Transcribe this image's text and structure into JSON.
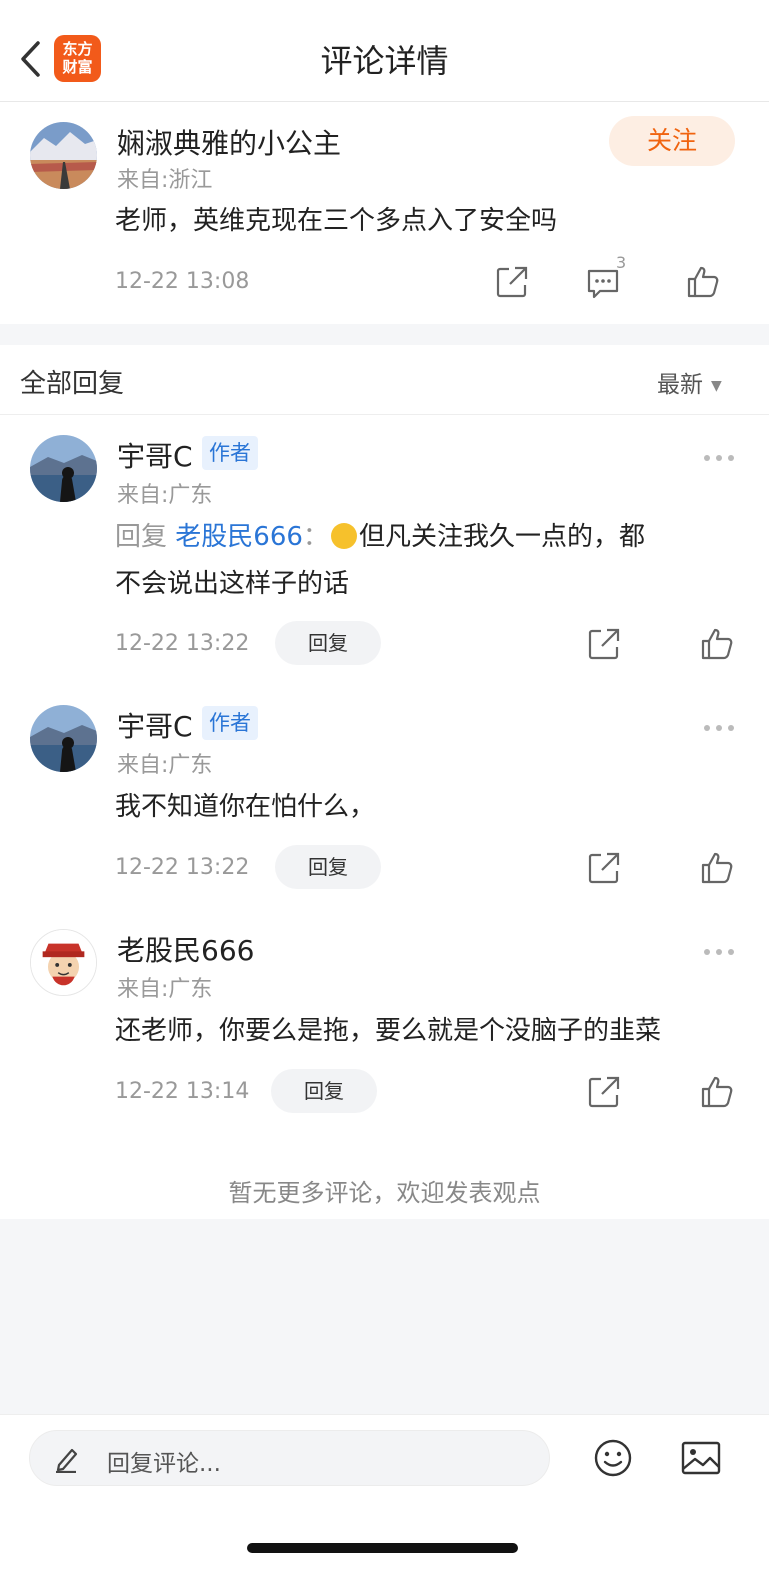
{
  "header": {
    "title": "评论详情",
    "logo_line1": "东方",
    "logo_line2": "财富"
  },
  "main_comment": {
    "author": "娴淑典雅的小公主",
    "origin": "来自:浙江",
    "follow_label": "关注",
    "text": "老师，英维克现在三个多点入了安全吗",
    "time": "12-22 13:08",
    "comment_count": "3"
  },
  "replies_header": {
    "title": "全部回复",
    "sort_label": "最新"
  },
  "replies": [
    {
      "author": "宇哥C",
      "badge": "作者",
      "origin": "来自:广东",
      "reply_prefix": "回复",
      "reply_to": "老股民666",
      "reply_sep": "：",
      "text_line1": "但凡关注我久一点的，都",
      "text_line2": "不会说出这样子的话",
      "time": "12-22 13:22",
      "reply_label": "回复"
    },
    {
      "author": "宇哥C",
      "badge": "作者",
      "origin": "来自:广东",
      "text": "我不知道你在怕什么，",
      "time": "12-22 13:22",
      "reply_label": "回复"
    },
    {
      "author": "老股民666",
      "origin": "来自:广东",
      "text": "还老师，你要么是拖，要么就是个没脑子的韭菜",
      "time": "12-22 13:14",
      "reply_label": "回复"
    }
  ],
  "no_more_text": "暂无更多评论，欢迎发表观点",
  "bottom_bar": {
    "input_placeholder": "回复评论..."
  },
  "icons": {
    "back": "chevron-left-icon",
    "share": "share-icon",
    "comment": "comment-icon",
    "like": "thumbs-up-icon",
    "more": "more-icon",
    "emoji": "emoji-icon",
    "image": "image-icon",
    "pen": "pen-icon"
  },
  "colors": {
    "brand": "#f25a1a",
    "follow_text": "#f0630f",
    "link_blue": "#2a75d6"
  }
}
